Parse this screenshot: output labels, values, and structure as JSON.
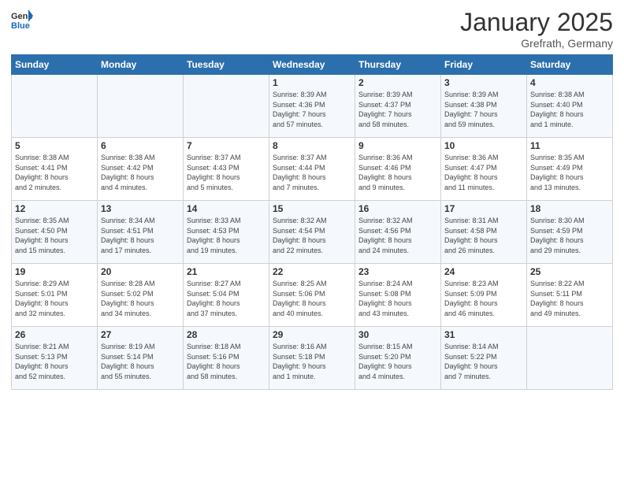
{
  "header": {
    "logo_general": "General",
    "logo_blue": "Blue",
    "month_title": "January 2025",
    "location": "Grefrath, Germany"
  },
  "weekdays": [
    "Sunday",
    "Monday",
    "Tuesday",
    "Wednesday",
    "Thursday",
    "Friday",
    "Saturday"
  ],
  "weeks": [
    [
      {
        "day": "",
        "info": ""
      },
      {
        "day": "",
        "info": ""
      },
      {
        "day": "",
        "info": ""
      },
      {
        "day": "1",
        "info": "Sunrise: 8:39 AM\nSunset: 4:36 PM\nDaylight: 7 hours\nand 57 minutes."
      },
      {
        "day": "2",
        "info": "Sunrise: 8:39 AM\nSunset: 4:37 PM\nDaylight: 7 hours\nand 58 minutes."
      },
      {
        "day": "3",
        "info": "Sunrise: 8:39 AM\nSunset: 4:38 PM\nDaylight: 7 hours\nand 59 minutes."
      },
      {
        "day": "4",
        "info": "Sunrise: 8:38 AM\nSunset: 4:40 PM\nDaylight: 8 hours\nand 1 minute."
      }
    ],
    [
      {
        "day": "5",
        "info": "Sunrise: 8:38 AM\nSunset: 4:41 PM\nDaylight: 8 hours\nand 2 minutes."
      },
      {
        "day": "6",
        "info": "Sunrise: 8:38 AM\nSunset: 4:42 PM\nDaylight: 8 hours\nand 4 minutes."
      },
      {
        "day": "7",
        "info": "Sunrise: 8:37 AM\nSunset: 4:43 PM\nDaylight: 8 hours\nand 5 minutes."
      },
      {
        "day": "8",
        "info": "Sunrise: 8:37 AM\nSunset: 4:44 PM\nDaylight: 8 hours\nand 7 minutes."
      },
      {
        "day": "9",
        "info": "Sunrise: 8:36 AM\nSunset: 4:46 PM\nDaylight: 8 hours\nand 9 minutes."
      },
      {
        "day": "10",
        "info": "Sunrise: 8:36 AM\nSunset: 4:47 PM\nDaylight: 8 hours\nand 11 minutes."
      },
      {
        "day": "11",
        "info": "Sunrise: 8:35 AM\nSunset: 4:49 PM\nDaylight: 8 hours\nand 13 minutes."
      }
    ],
    [
      {
        "day": "12",
        "info": "Sunrise: 8:35 AM\nSunset: 4:50 PM\nDaylight: 8 hours\nand 15 minutes."
      },
      {
        "day": "13",
        "info": "Sunrise: 8:34 AM\nSunset: 4:51 PM\nDaylight: 8 hours\nand 17 minutes."
      },
      {
        "day": "14",
        "info": "Sunrise: 8:33 AM\nSunset: 4:53 PM\nDaylight: 8 hours\nand 19 minutes."
      },
      {
        "day": "15",
        "info": "Sunrise: 8:32 AM\nSunset: 4:54 PM\nDaylight: 8 hours\nand 22 minutes."
      },
      {
        "day": "16",
        "info": "Sunrise: 8:32 AM\nSunset: 4:56 PM\nDaylight: 8 hours\nand 24 minutes."
      },
      {
        "day": "17",
        "info": "Sunrise: 8:31 AM\nSunset: 4:58 PM\nDaylight: 8 hours\nand 26 minutes."
      },
      {
        "day": "18",
        "info": "Sunrise: 8:30 AM\nSunset: 4:59 PM\nDaylight: 8 hours\nand 29 minutes."
      }
    ],
    [
      {
        "day": "19",
        "info": "Sunrise: 8:29 AM\nSunset: 5:01 PM\nDaylight: 8 hours\nand 32 minutes."
      },
      {
        "day": "20",
        "info": "Sunrise: 8:28 AM\nSunset: 5:02 PM\nDaylight: 8 hours\nand 34 minutes."
      },
      {
        "day": "21",
        "info": "Sunrise: 8:27 AM\nSunset: 5:04 PM\nDaylight: 8 hours\nand 37 minutes."
      },
      {
        "day": "22",
        "info": "Sunrise: 8:25 AM\nSunset: 5:06 PM\nDaylight: 8 hours\nand 40 minutes."
      },
      {
        "day": "23",
        "info": "Sunrise: 8:24 AM\nSunset: 5:08 PM\nDaylight: 8 hours\nand 43 minutes."
      },
      {
        "day": "24",
        "info": "Sunrise: 8:23 AM\nSunset: 5:09 PM\nDaylight: 8 hours\nand 46 minutes."
      },
      {
        "day": "25",
        "info": "Sunrise: 8:22 AM\nSunset: 5:11 PM\nDaylight: 8 hours\nand 49 minutes."
      }
    ],
    [
      {
        "day": "26",
        "info": "Sunrise: 8:21 AM\nSunset: 5:13 PM\nDaylight: 8 hours\nand 52 minutes."
      },
      {
        "day": "27",
        "info": "Sunrise: 8:19 AM\nSunset: 5:14 PM\nDaylight: 8 hours\nand 55 minutes."
      },
      {
        "day": "28",
        "info": "Sunrise: 8:18 AM\nSunset: 5:16 PM\nDaylight: 8 hours\nand 58 minutes."
      },
      {
        "day": "29",
        "info": "Sunrise: 8:16 AM\nSunset: 5:18 PM\nDaylight: 9 hours\nand 1 minute."
      },
      {
        "day": "30",
        "info": "Sunrise: 8:15 AM\nSunset: 5:20 PM\nDaylight: 9 hours\nand 4 minutes."
      },
      {
        "day": "31",
        "info": "Sunrise: 8:14 AM\nSunset: 5:22 PM\nDaylight: 9 hours\nand 7 minutes."
      },
      {
        "day": "",
        "info": ""
      }
    ]
  ]
}
